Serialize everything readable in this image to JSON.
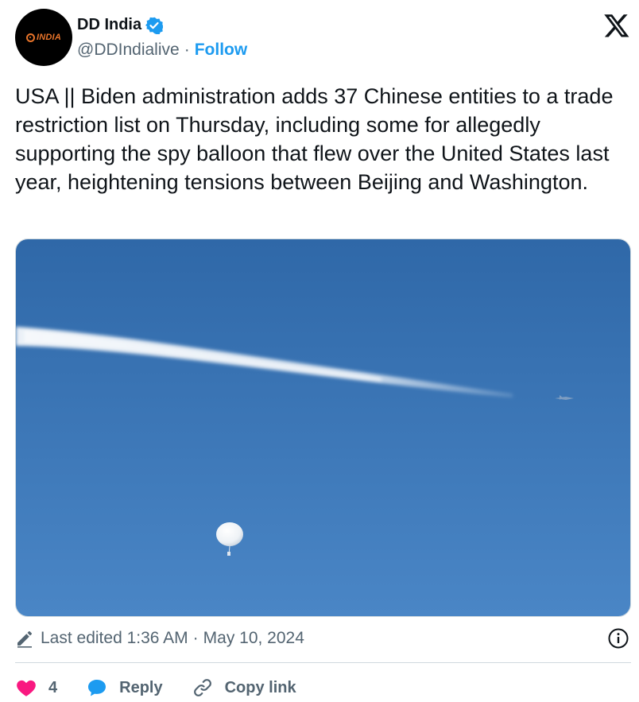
{
  "author": {
    "display_name": "DD India",
    "handle": "@DDIndialive",
    "separator": "·",
    "follow_label": "Follow",
    "avatar_brand": "INDIA",
    "verified": true
  },
  "tweet": {
    "text": "USA || Biden administration adds 37 Chinese entities to a trade restriction list on Thursday, including some for allegedly supporting the spy balloon that flew over the United States last year, heightening tensions between Beijing and Washington."
  },
  "edited": {
    "label": "Last edited 1:36 AM",
    "separator": "·",
    "date": "May 10, 2024"
  },
  "actions": {
    "like_count": "4",
    "reply_label": "Reply",
    "copy_link_label": "Copy link"
  },
  "colors": {
    "accent": "#1d9bf0",
    "like": "#f91880",
    "sky_top": "#2f68a8",
    "sky_bottom": "#4a86c6",
    "secondary_text": "#536471"
  },
  "icons": {
    "verified": "verified-badge-icon",
    "x_logo": "x-logo-icon",
    "pencil": "pencil-icon",
    "info": "info-icon",
    "like": "heart-icon",
    "reply": "speech-bubble-icon",
    "copy_link": "link-icon"
  }
}
